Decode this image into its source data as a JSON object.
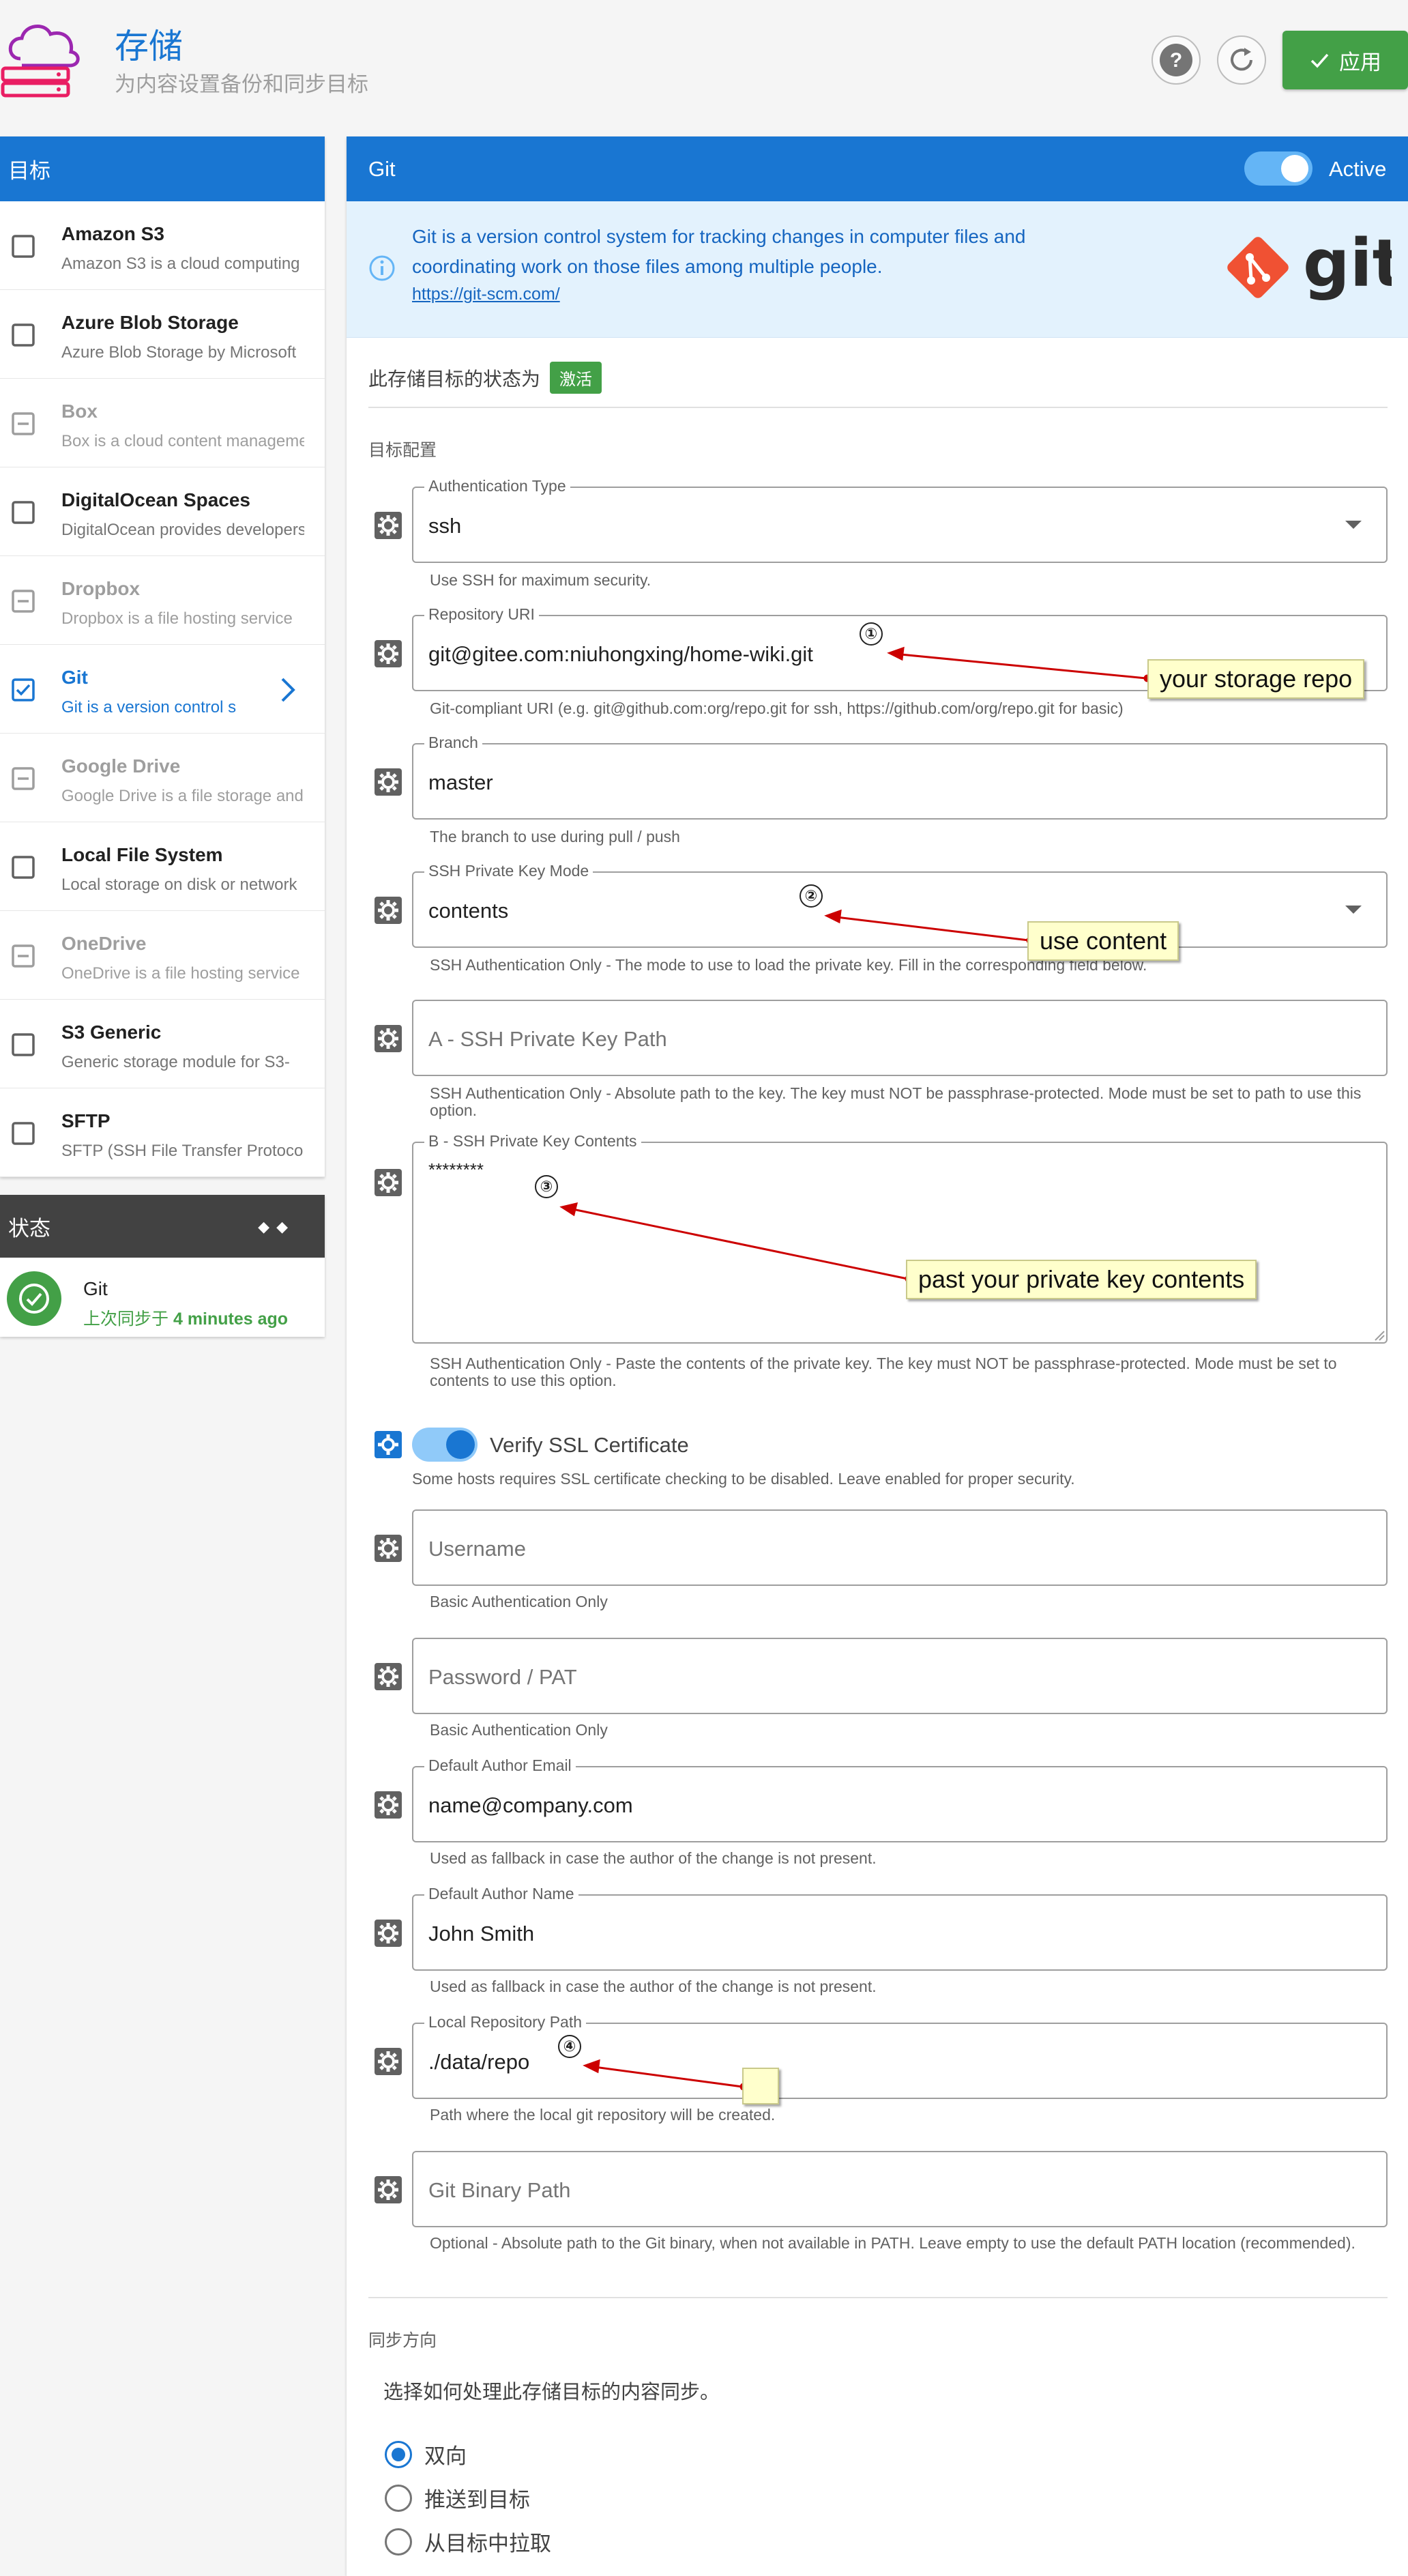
{
  "header": {
    "title": "存储",
    "subtitle": "为内容设置备份和同步目标",
    "apply_label": "应用"
  },
  "sidebar": {
    "title": "目标",
    "items": [
      {
        "title": "Amazon S3",
        "desc": "Amazon S3 is a cloud computing",
        "state": "unchecked"
      },
      {
        "title": "Azure Blob Storage",
        "desc": "Azure Blob Storage by Microsoft",
        "state": "unchecked"
      },
      {
        "title": "Box",
        "desc": "Box is a cloud content management",
        "state": "disabled"
      },
      {
        "title": "DigitalOcean Spaces",
        "desc": "DigitalOcean provides developers",
        "state": "unchecked"
      },
      {
        "title": "Dropbox",
        "desc": "Dropbox is a file hosting service",
        "state": "disabled"
      },
      {
        "title": "Git",
        "desc": "Git is a version control s",
        "state": "checked"
      },
      {
        "title": "Google Drive",
        "desc": "Google Drive is a file storage and",
        "state": "disabled"
      },
      {
        "title": "Local File System",
        "desc": "Local storage on disk or network",
        "state": "unchecked"
      },
      {
        "title": "OneDrive",
        "desc": "OneDrive is a file hosting service",
        "state": "disabled"
      },
      {
        "title": "S3 Generic",
        "desc": "Generic storage module for S3-",
        "state": "unchecked"
      },
      {
        "title": "SFTP",
        "desc": "SFTP (SSH File Transfer Protocol",
        "state": "unchecked"
      }
    ]
  },
  "status": {
    "title": "状态",
    "target": "Git",
    "last_sync_prefix": "上次同步于",
    "last_sync_time": "4 minutes ago"
  },
  "main": {
    "title": "Git",
    "active_label": "Active",
    "info_text": "Git is a version control system for tracking changes in computer files and coordinating work on those files among multiple people.",
    "info_link": "https://git-scm.com/",
    "logo_text": "git",
    "state_prefix": "此存储目标的状态为",
    "state_badge": "激活",
    "config_section": "目标配置",
    "fields": {
      "auth_type": {
        "label": "Authentication Type",
        "value": "ssh",
        "hint": "Use SSH for maximum security."
      },
      "repo_uri": {
        "label": "Repository URI",
        "value": "git@gitee.com:niuhongxing/home-wiki.git",
        "hint": "Git-compliant URI (e.g. git@github.com:org/repo.git for ssh, https://github.com/org/repo.git for basic)"
      },
      "branch": {
        "label": "Branch",
        "value": "master",
        "hint": "The branch to use during pull / push"
      },
      "key_mode": {
        "label": "SSH Private Key Mode",
        "value": "contents",
        "hint": "SSH Authentication Only - The mode to use to load the private key. Fill in the corresponding field below."
      },
      "key_path": {
        "placeholder": "A - SSH Private Key Path",
        "hint": "SSH Authentication Only - Absolute path to the key. The key must NOT be passphrase-protected. Mode must be set to path to use this option."
      },
      "key_contents": {
        "label": "B - SSH Private Key Contents",
        "value": "********",
        "hint": "SSH Authentication Only - Paste the contents of the private key. The key must NOT be passphrase-protected. Mode must be set to contents to use this option."
      },
      "verify_ssl": {
        "label": "Verify SSL Certificate",
        "hint": "Some hosts requires SSL certificate checking to be disabled. Leave enabled for proper security."
      },
      "username": {
        "placeholder": "Username",
        "hint": "Basic Authentication Only"
      },
      "password": {
        "placeholder": "Password / PAT",
        "hint": "Basic Authentication Only"
      },
      "author_email": {
        "label": "Default Author Email",
        "value": "name@company.com",
        "hint": "Used as fallback in case the author of the change is not present."
      },
      "author_name": {
        "label": "Default Author Name",
        "value": "John Smith",
        "hint": "Used as fallback in case the author of the change is not present."
      },
      "local_path": {
        "label": "Local Repository Path",
        "value": "./data/repo",
        "hint": "Path where the local git repository will be created."
      },
      "git_binary": {
        "placeholder": "Git Binary Path",
        "hint": "Optional - Absolute path to the Git binary, when not available in PATH. Leave empty to use the default PATH location (recommended)."
      }
    },
    "sync": {
      "section": "同步方向",
      "desc": "选择如何处理此存储目标的内容同步。",
      "options": [
        "双向",
        "推送到目标",
        "从目标中拉取"
      ],
      "selected": "双向"
    }
  },
  "annotations": {
    "n1": "①",
    "n2": "②",
    "n3": "③",
    "n4": "④",
    "c1": "your storage repo",
    "c2": "use content",
    "c3": "past your private key contents",
    "c4": ""
  },
  "colors": {
    "primary": "#1976d2",
    "success": "#43a047",
    "dark": "#424242",
    "git_orange": "#f05133",
    "callout_bg": "#ffffcc",
    "arrow": "#cc0000"
  }
}
